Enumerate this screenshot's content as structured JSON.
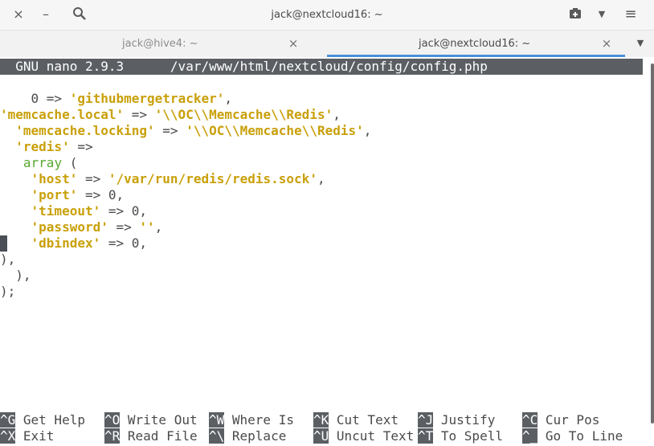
{
  "window": {
    "title": "jack@nextcloud16: ~",
    "close_icon": "×",
    "minimize_icon": "–",
    "search_icon": "search-icon",
    "new_tab_icon": "new-tab-icon",
    "menu_icon": "≡"
  },
  "tabs": [
    {
      "label": "jack@hive4: ~",
      "active": false
    },
    {
      "label": "jack@nextcloud16: ~",
      "active": true
    }
  ],
  "nano": {
    "version": "GNU nano 2.9.3",
    "file_path": "/var/www/html/nextcloud/config/config.php"
  },
  "code_lines": [
    {
      "indent": "    ",
      "pre": "0 => ",
      "key": "'githubmergetracker'",
      "post": ","
    },
    {
      "indent": "",
      "pre": "",
      "key": "'memcache.local'",
      "post": " => ",
      "key2": "'\\\\OC\\\\Memcache\\\\Redis'",
      "post2": ","
    },
    {
      "indent": "  ",
      "pre": "",
      "key": "'memcache.locking'",
      "post": " => ",
      "key2": "'\\\\OC\\\\Memcache\\\\Redis'",
      "post2": ","
    },
    {
      "indent": "  ",
      "pre": "",
      "key": "'redis'",
      "post": " =>"
    },
    {
      "indent": "   ",
      "kw": "array",
      "post": " ("
    },
    {
      "indent": "    ",
      "pre": "",
      "key": "'host'",
      "post": " => ",
      "key2": "'/var/run/redis/redis.sock'",
      "post2": ","
    },
    {
      "indent": "    ",
      "pre": "",
      "key": "'port'",
      "post": " => 0,"
    },
    {
      "indent": "    ",
      "pre": "",
      "key": "'timeout'",
      "post": " => 0,"
    },
    {
      "indent": "    ",
      "pre": "",
      "key": "'password'",
      "post": " => ",
      "key2": "''",
      "post2": ","
    },
    {
      "indent": "    ",
      "pre": "",
      "key": "'dbindex'",
      "post": " => 0,"
    },
    {
      "indent": "",
      "pre": "),"
    },
    {
      "indent": "  ",
      "pre": "),"
    },
    {
      "indent": "",
      "pre": ");"
    }
  ],
  "shortcuts": [
    [
      {
        "key": "^G",
        "desc": "Get Help"
      },
      {
        "key": "^O",
        "desc": "Write Out"
      },
      {
        "key": "^W",
        "desc": "Where Is"
      },
      {
        "key": "^K",
        "desc": "Cut Text"
      },
      {
        "key": "^J",
        "desc": "Justify"
      },
      {
        "key": "^C",
        "desc": "Cur Pos"
      }
    ],
    [
      {
        "key": "^X",
        "desc": "Exit"
      },
      {
        "key": "^R",
        "desc": "Read File"
      },
      {
        "key": "^\\",
        "desc": "Replace"
      },
      {
        "key": "^U",
        "desc": "Uncut Text"
      },
      {
        "key": "^T",
        "desc": "To Spell"
      },
      {
        "key": "^_",
        "desc": "Go To Line"
      }
    ]
  ],
  "colors": {
    "key_string": "#c9a00a",
    "keyword": "#5aa832",
    "header_bg": "#5b5f64",
    "tab_accent": "#4a90d9"
  }
}
